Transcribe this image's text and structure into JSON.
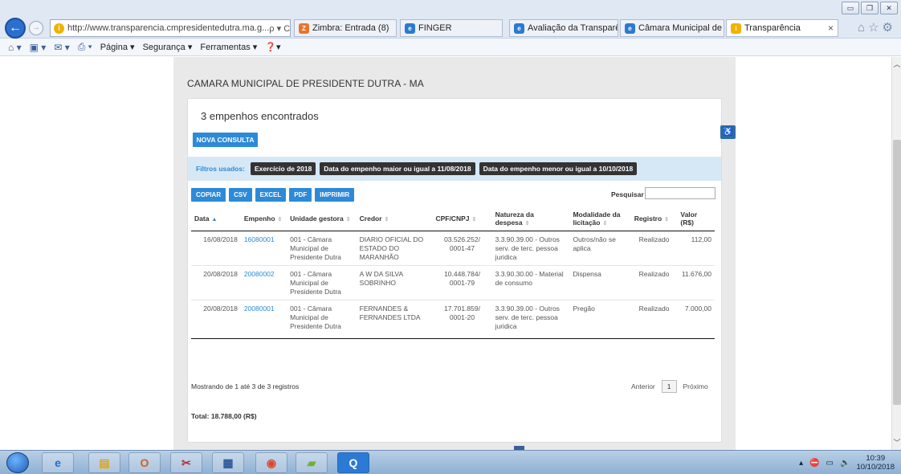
{
  "browser": {
    "url": "http://www.transparencia.cmpresidentedutra.ma.g...",
    "address_actions": "ρ ▾ C",
    "tabs": [
      {
        "title": "Zimbra: Entrada (8)",
        "icon_color": "#e8742a"
      },
      {
        "title": "FINGER",
        "icon_color": "#2a7bd0"
      },
      {
        "title": "Avaliação da Transparê...",
        "icon_color": "#2a7bd0"
      },
      {
        "title": "Câmara Municipal de P...",
        "icon_color": "#2a7bd0"
      },
      {
        "title": "Transparência",
        "icon_color": "#f2b200",
        "active": true
      }
    ],
    "tab_close": "×",
    "command_bar": {
      "page": "Página ▾",
      "security": "Segurança ▾",
      "tools": "Ferramentas ▾",
      "help": "❓▾"
    }
  },
  "page": {
    "site_title": "CAMARA MUNICIPAL DE PRESIDENTE DUTRA - MA",
    "found_text": "3 empenhos encontrados",
    "new_query_label": "NOVA CONSULTA",
    "filters_label": "Filtros usados:",
    "filters": [
      "Exercício de 2018",
      "Data do empenho maior ou igual a 11/08/2018",
      "Data do empenho menor ou igual a 10/10/2018"
    ],
    "toolbar": [
      "COPIAR",
      "CSV",
      "EXCEL",
      "PDF",
      "IMPRIMIR"
    ],
    "search_label": "Pesquisar",
    "search_value": "",
    "columns": [
      "Data",
      "Empenho",
      "Unidade gestora",
      "Credor",
      "CPF/CNPJ",
      "Natureza da despesa",
      "Modalidade da licitação",
      "Registro",
      "Valor (R$)"
    ],
    "rows": [
      {
        "data": "16/08/2018",
        "empenho": "16080001",
        "unidade": "001 - Câmara Municipal de Presidente Dutra",
        "credor": "DIARIO OFICIAL DO ESTADO DO MARANHÃO",
        "cpf_cnpj": "03.526.252/ 0001-47",
        "natureza": "3.3.90.39.00 - Outros serv. de terc. pessoa juridica",
        "modalidade": "Outros/não se aplica",
        "registro": "Realizado",
        "valor": "112,00"
      },
      {
        "data": "20/08/2018",
        "empenho": "20080002",
        "unidade": "001 - Câmara Municipal de Presidente Dutra",
        "credor": "A W DA SILVA SOBRINHO",
        "cpf_cnpj": "10.448.784/ 0001-79",
        "natureza": "3.3.90.30.00 - Material de consumo",
        "modalidade": "Dispensa",
        "registro": "Realizado",
        "valor": "11.676,00"
      },
      {
        "data": "20/08/2018",
        "empenho": "20080001",
        "unidade": "001 - Câmara Municipal de Presidente Dutra",
        "credor": "FERNANDES & FERNANDES LTDA",
        "cpf_cnpj": "17.701.859/ 0001-20",
        "natureza": "3.3.90.39.00 - Outros serv. de terc. pessoa juridica",
        "modalidade": "Pregão",
        "registro": "Realizado",
        "valor": "7.000,00"
      }
    ],
    "showing_text": "Mostrando de 1 até 3 de 3 registros",
    "pager": {
      "previous": "Anterior",
      "current": "1",
      "next": "Próximo"
    },
    "total_text": "Total: 18.788,00 (R$)"
  },
  "taskbar": {
    "time": "10:39",
    "date": "10/10/2018"
  }
}
